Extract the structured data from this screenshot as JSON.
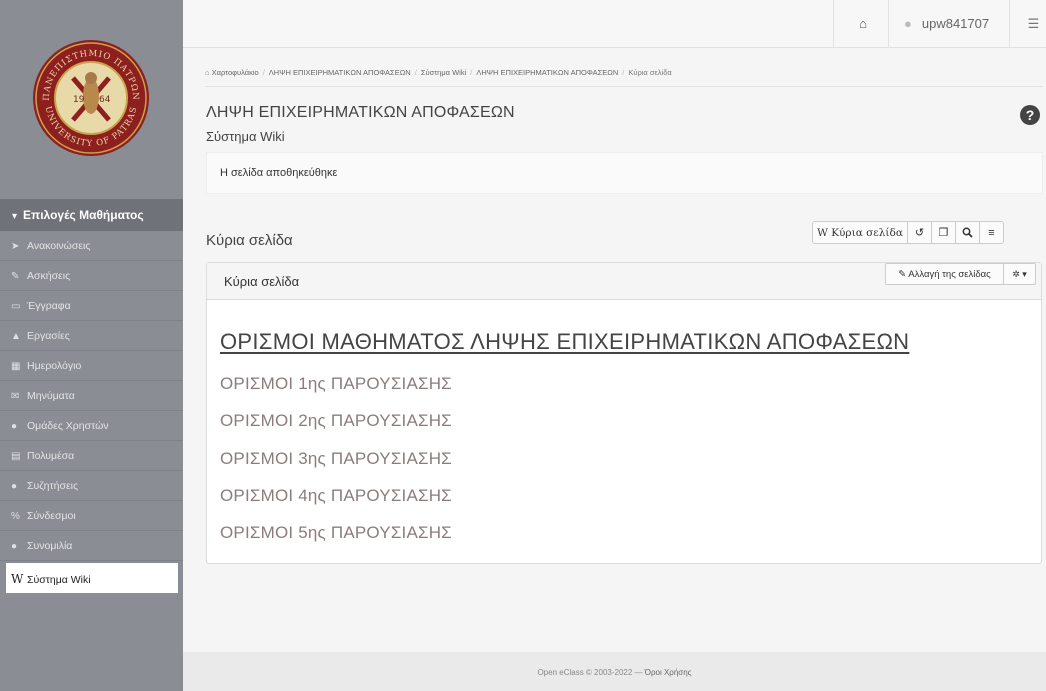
{
  "sidebar": {
    "logo": {
      "ring_top": "ΠΑΝΕΠΙΣΤΗΜΙΟ ΠΑΤΡΩΝ",
      "ring_bottom": "UNIVERSITY OF PATRAS",
      "year_left": "19",
      "year_right": "64",
      "colors": {
        "ring": "#8e1f1f",
        "inner": "#e8d9a8",
        "gold": "#c9a44a"
      }
    },
    "menu_header": "Επιλογές Μαθήματος",
    "items": [
      {
        "label": "Ανακοινώσεις",
        "icon": "bullhorn-icon",
        "glyph": "✉"
      },
      {
        "label": "Ασκήσεις",
        "icon": "edit-icon",
        "glyph": "✎"
      },
      {
        "label": "Έγγραφα",
        "icon": "folder-open-icon",
        "glyph": "▭"
      },
      {
        "label": "Εργασίες",
        "icon": "flask-icon",
        "glyph": "▲"
      },
      {
        "label": "Ημερολόγιο",
        "icon": "calendar-icon",
        "glyph": "▦"
      },
      {
        "label": "Μηνύματα",
        "icon": "envelope-icon",
        "glyph": "✉"
      },
      {
        "label": "Ομάδες Χρηστών",
        "icon": "users-icon",
        "glyph": "●"
      },
      {
        "label": "Πολυμέσα",
        "icon": "film-icon",
        "glyph": "▤"
      },
      {
        "label": "Συζητήσεις",
        "icon": "comments-icon",
        "glyph": "●"
      },
      {
        "label": "Σύνδεσμοι",
        "icon": "link-icon",
        "glyph": "%"
      },
      {
        "label": "Συνομιλία",
        "icon": "chat-icon",
        "glyph": "●"
      },
      {
        "label": "Σύστημα Wiki",
        "icon": "wikipedia-icon",
        "glyph": "W",
        "active": true
      }
    ]
  },
  "topbar": {
    "home_glyph": "⌂",
    "user_glyph": "●",
    "username": "upw841707",
    "settings_glyph": "☰"
  },
  "breadcrumb": {
    "home_glyph": "⌂",
    "items": [
      "Χαρτοφυλάκιο",
      "ΛΗΨΗ ΕΠΙΧΕΙΡΗΜΑΤΙΚΩΝ ΑΠΟΦΑΣΕΩΝ",
      "Σύστημα Wiki",
      "ΛΗΨΗ ΕΠΙΧΕΙΡΗΜΑΤΙΚΩΝ ΑΠΟΦΑΣΕΩΝ",
      "Κύρια σελίδα"
    ],
    "separator": "/"
  },
  "header": {
    "course_title": "ΛΗΨΗ ΕΠΙΧΕΙΡΗΜΑΤΙΚΩΝ ΑΠΟΦΑΣΕΩΝ",
    "module_title": "Σύστημα Wiki",
    "help_glyph": "?"
  },
  "alert": {
    "message": "Η σελίδα αποθηκεύθηκε"
  },
  "page": {
    "heading": "Κύρια σελίδα"
  },
  "toolbar": {
    "wiki_button": "W Κύρια σελίδα",
    "history_glyph": "↺",
    "copy_glyph": "❐",
    "search_glyph": "⚲",
    "list_glyph": "≡"
  },
  "panel": {
    "title": "Κύρια σελίδα",
    "edit_button": "✎ Αλλαγή της σελίδας",
    "gear_button": "✲ ▾",
    "content_heading": "ΟΡΙΣΜΟΙ ΜΑΘΗΜΑΤΟΣ ΛΗΨΗΣ ΕΠΙΧΕΙΡΗΜΑΤΙΚΩΝ ΑΠΟΦΑΣΕΩΝ",
    "links": [
      "ΟΡΙΣΜΟΙ 1ης ΠΑΡΟΥΣΙΑΣΗΣ",
      "ΟΡΙΣΜΟΙ 2ης ΠΑΡΟΥΣΙΑΣΗΣ",
      "ΟΡΙΣΜΟΙ 3ης ΠΑΡΟΥΣΙΑΣΗΣ",
      "ΟΡΙΣΜΟΙ 4ης ΠΑΡΟΥΣΙΑΣΗΣ",
      "ΟΡΙΣΜΟΙ 5ης ΠΑΡΟΥΣΙΑΣΗΣ"
    ]
  },
  "footer": {
    "copyright": "Open eClass © 2003-2022 —",
    "terms": "Όροι Χρήσης"
  },
  "colors": {
    "sidebar_bg": "#8a8d93",
    "sidebar_header_bg": "#6f7278",
    "link_color": "#8c7c7c",
    "heading_color": "#444444"
  }
}
